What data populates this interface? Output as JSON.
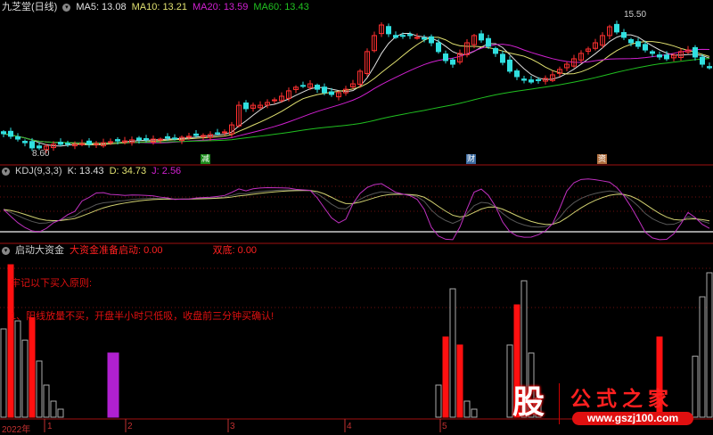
{
  "header": {
    "stock": "九芝堂(日线)",
    "ma5": "MA5: 13.08",
    "ma10": "MA10: 13.21",
    "ma20": "MA20: 13.59",
    "ma60": "MA60: 13.43"
  },
  "kdj_header": {
    "name": "KDJ(9,3,3)",
    "k": "K: 13.43",
    "d": "D: 34.73",
    "j": "J: 2.56"
  },
  "fund_header": {
    "name": "启动大资金",
    "ready": "大资金准备启动: 0.00",
    "double": "双底: 0.00"
  },
  "notes": [
    "牢记以下买入原则:",
    "1、阳线放量不买，开盘半小时只低吸，收盘前三分钟买确认!"
  ],
  "markers": [
    {
      "label": "减",
      "color": "#1a8a1a"
    },
    {
      "label": "财",
      "color": "#3a6aa0"
    },
    {
      "label": "资",
      "color": "#b07040"
    }
  ],
  "price_labels": {
    "high": "15.50",
    "low": "8.60"
  },
  "axis": {
    "year": "2022年",
    "months": [
      "1",
      "2",
      "3",
      "4",
      "5"
    ]
  },
  "logo": {
    "icon": "股",
    "title": "公式之家",
    "url": "www.gszj100.com"
  },
  "colors": {
    "ma5": "#e0e0e0",
    "ma10": "#e0e070",
    "ma20": "#d020d0",
    "ma60": "#20c020",
    "up": "#ff3030",
    "down": "#30e0e0"
  },
  "chart_data": {
    "type": "candlestick",
    "closes": [
      9.58,
      9.45,
      9.31,
      9.13,
      8.87,
      8.87,
      8.96,
      9.05,
      9.05,
      9.09,
      9.05,
      9.09,
      9.05,
      9.09,
      9.13,
      9.18,
      9.22,
      9.22,
      9.27,
      9.27,
      9.27,
      9.31,
      9.31,
      9.36,
      9.36,
      9.4,
      9.45,
      9.49,
      9.49,
      9.54,
      9.58,
      9.67,
      10.02,
      11.0,
      10.83,
      11.0,
      11.0,
      11.14,
      11.27,
      11.45,
      11.72,
      11.9,
      11.98,
      12.07,
      11.8,
      11.63,
      11.54,
      11.63,
      11.8,
      12.07,
      12.7,
      13.68,
      14.48,
      15.01,
      14.57,
      14.39,
      14.48,
      14.48,
      14.39,
      14.3,
      14.12,
      13.68,
      13.23,
      13.05,
      13.59,
      14.12,
      14.48,
      14.26,
      13.94,
      13.59,
      13.14,
      12.7,
      12.43,
      12.25,
      12.16,
      12.25,
      12.34,
      12.52,
      12.79,
      13.05,
      13.32,
      13.59,
      13.81,
      14.12,
      14.48,
      14.92,
      14.66,
      14.39,
      14.12,
      13.94,
      13.76,
      13.59,
      13.41,
      13.32,
      13.5,
      13.68,
      13.76,
      13.41,
      13.05,
      12.87
    ],
    "ylim": [
      8.6,
      15.5
    ],
    "fund_bars": [
      {
        "i": 0,
        "v": 55,
        "c": "gray"
      },
      {
        "i": 1,
        "v": 95,
        "c": "red"
      },
      {
        "i": 2,
        "v": 60,
        "c": "gray"
      },
      {
        "i": 3,
        "v": 48,
        "c": "gray"
      },
      {
        "i": 4,
        "v": 62,
        "c": "red"
      },
      {
        "i": 5,
        "v": 35,
        "c": "gray"
      },
      {
        "i": 6,
        "v": 20,
        "c": "gray"
      },
      {
        "i": 7,
        "v": 10,
        "c": "gray"
      },
      {
        "i": 8,
        "v": 5,
        "c": "gray"
      },
      {
        "i": 15,
        "v": 40,
        "c": "magenta"
      },
      {
        "i": 61,
        "v": 20,
        "c": "gray"
      },
      {
        "i": 62,
        "v": 50,
        "c": "red"
      },
      {
        "i": 63,
        "v": 80,
        "c": "gray"
      },
      {
        "i": 64,
        "v": 45,
        "c": "red"
      },
      {
        "i": 65,
        "v": 10,
        "c": "gray"
      },
      {
        "i": 66,
        "v": 5,
        "c": "gray"
      },
      {
        "i": 71,
        "v": 45,
        "c": "gray"
      },
      {
        "i": 72,
        "v": 70,
        "c": "red"
      },
      {
        "i": 73,
        "v": 85,
        "c": "gray"
      },
      {
        "i": 74,
        "v": 40,
        "c": "gray"
      },
      {
        "i": 75,
        "v": 12,
        "c": "gray"
      },
      {
        "i": 92,
        "v": 50,
        "c": "red"
      },
      {
        "i": 97,
        "v": 38,
        "c": "gray"
      },
      {
        "i": 98,
        "v": 75,
        "c": "gray"
      },
      {
        "i": 99,
        "v": 90,
        "c": "gray"
      }
    ]
  }
}
